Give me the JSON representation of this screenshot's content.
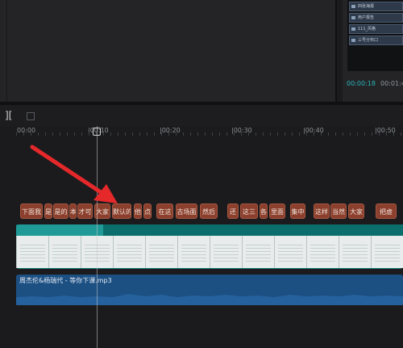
{
  "preview": {
    "current_time": "00:00:18",
    "total_time": "00:01:4",
    "thumb_rows": [
      "四张海报",
      "用户报告",
      "111_风格",
      "三号分布口",
      "自序录全(1)"
    ]
  },
  "toolbar": {
    "split_icon": "]["
  },
  "ruler": {
    "labels": [
      "00:00",
      "|00:10",
      "|00:20",
      "|00:30",
      "|00:40",
      "|00:50"
    ]
  },
  "text_clips": [
    "下面我",
    "是",
    "是的",
    "本",
    "才可",
    "大家",
    "默认的",
    "他",
    "点",
    "在这",
    "古场面",
    "然后",
    "还",
    "这三",
    "各",
    "里面",
    "集中",
    "这样",
    "当然",
    "大家",
    "把虚"
  ],
  "audio": {
    "label": "周杰伦&杨瑞代 - 等你下课.mp3"
  },
  "colors": {
    "accent_time": "#27b3b7",
    "text_clip": "#8b3f2c",
    "video": "#0f7a78",
    "audio": "#1c4f82",
    "annotation_arrow": "#e5282a"
  }
}
